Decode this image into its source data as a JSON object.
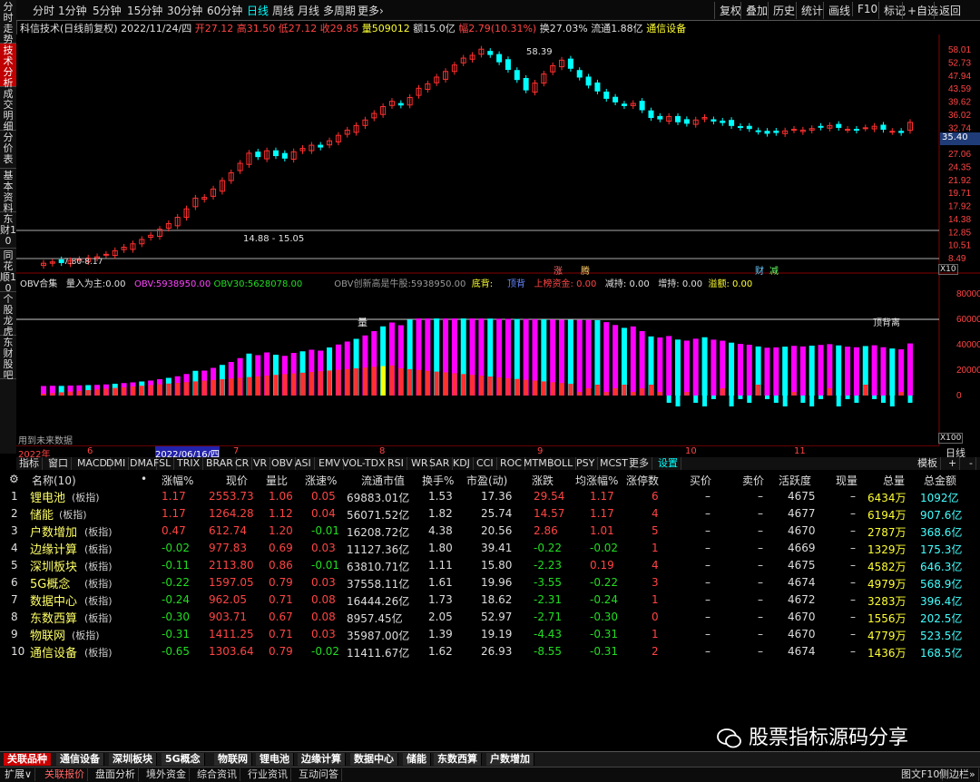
{
  "left_tabs": [
    {
      "label": "分时走势",
      "active": false
    },
    {
      "label": "技术分析",
      "active": true
    },
    {
      "label": "成交明细",
      "active": false
    },
    {
      "label": "分价表",
      "active": false
    },
    {
      "label": "基本资料",
      "active": false
    },
    {
      "label": "东财10",
      "active": false
    },
    {
      "label": "同花顺10",
      "active": false
    },
    {
      "label": "个股龙虎",
      "active": false
    },
    {
      "label": "东财股吧",
      "active": false
    }
  ],
  "toolbar": {
    "periods": [
      "分时",
      "1分钟",
      "5分钟",
      "15分钟",
      "30分钟",
      "60分钟",
      "日线",
      "周线",
      "月线",
      "多周期",
      "更多›"
    ],
    "selected": "日线",
    "right": [
      "复权",
      "叠加",
      "历史",
      "统计",
      "画线",
      "F10",
      "标记",
      "+自选",
      "返回"
    ]
  },
  "info": {
    "stock": "科信技术(日线前复权)",
    "date": "2022/11/24/四",
    "open_label": "开",
    "open": "27.12",
    "high_label": "高",
    "high": "31.50",
    "low_label": "低",
    "low": "27.12",
    "close_label": "收",
    "close": "29.85",
    "vol_label": "量",
    "vol": "509012",
    "amt_label": "额",
    "amt": "15.0亿",
    "chg_label": "幅",
    "chg": "2.79(10.31%)",
    "turn_label": "换",
    "turn": "27.03%",
    "float_label": "流通",
    "float": "1.88亿",
    "industry": "通信设备"
  },
  "price_axis": [
    "58.01",
    "52.73",
    "47.94",
    "43.59",
    "39.62",
    "36.02",
    "32.74",
    "29.77",
    "27.06",
    "24.35",
    "21.92",
    "19.71",
    "17.92",
    "14.38",
    "12.85",
    "10.51",
    "8.49"
  ],
  "price_axis_current": "35.40",
  "scale_label": "X10",
  "annotations": {
    "high": "58.39",
    "range": "14.88 - 15.05",
    "low": "7.80-8.17",
    "zhang": "涨",
    "teng": "腾",
    "cai": "财",
    "jian": "减"
  },
  "obv": {
    "title": "OBV合集",
    "liang_label": "量入为主:",
    "liang": "0.00",
    "obv_label": "OBV:",
    "obv": "5938950.00",
    "obv30_label": "OBV30:",
    "obv30": "5628078.00",
    "newhigh_label": "OBV创新高是牛股:",
    "newhigh": "5938950.00",
    "dibei": "底背:",
    "dingbei": "顶背",
    "shangbang": "上榜资金: 0.00",
    "jianchi": "减持: 0.00",
    "zengchi": "增持: 0.00",
    "yijia": "溢额: 0.00",
    "label_liang": "量",
    "label_beili": "顶背离",
    "future": "用到未来数据",
    "axis": [
      "80000",
      "60000",
      "40000",
      "20000",
      "0"
    ],
    "scale": "X100"
  },
  "chart_data": {
    "type": "candlestick",
    "title": "科信技术(日线前复权)",
    "closes": [
      8.2,
      8.3,
      8.25,
      8.4,
      8.5,
      8.6,
      8.7,
      8.9,
      9.2,
      9.5,
      9.8,
      10.2,
      10.6,
      11.2,
      11.8,
      12.5,
      13.5,
      14.9,
      15.0,
      16.2,
      17.5,
      18.8,
      20.5,
      22.5,
      21.8,
      23.0,
      22.0,
      21.5,
      22.8,
      23.5,
      24.2,
      23.8,
      25.2,
      26.5,
      27.8,
      29.0,
      30.5,
      32.4,
      34.5,
      36.2,
      35.0,
      37.5,
      40.8,
      42.5,
      45.2,
      47.6,
      50.5,
      53.8,
      55.2,
      58.39,
      55.6,
      52.0,
      48.5,
      44.2,
      40.2,
      42.8,
      46.5,
      50.2,
      52.8,
      49.0,
      45.2,
      42.0,
      39.8,
      37.2,
      36.0,
      34.8,
      35.5,
      33.5,
      31.2,
      30.8,
      31.5,
      30.0,
      29.6,
      30.5,
      31.2,
      30.2,
      29.8,
      29.0,
      28.5,
      28.2,
      27.5,
      27.0,
      27.2,
      27.6,
      28.0,
      27.8,
      28.2,
      28.6,
      29.0,
      28.5,
      28.0,
      27.8,
      28.4,
      28.8,
      28.0,
      27.5,
      27.2,
      29.85
    ],
    "ylim": [
      8.49,
      58.01
    ],
    "volume_axis": [
      "80000",
      "60000",
      "40000",
      "20000",
      "0"
    ]
  },
  "dates": [
    {
      "label": "2022年"
    },
    {
      "label": "6"
    },
    {
      "label": "2022/06/16/四",
      "highlight": true
    },
    {
      "label": "7"
    },
    {
      "label": "8"
    },
    {
      "label": "9"
    },
    {
      "label": "10"
    },
    {
      "label": "11"
    }
  ],
  "date_right": "日线",
  "indicator_tabs": [
    "指标",
    "窗口",
    "MACD",
    "DMI",
    "DMA",
    "FSL",
    "TRIX",
    "BRAR",
    "CR",
    "VR",
    "OBV",
    "ASI",
    "EMV",
    "VOL-TDX",
    "RSI",
    "WR",
    "SAR",
    "KDJ",
    "CCI",
    "ROC",
    "MTM",
    "BOLL",
    "PSY",
    "MCST",
    "更多",
    "设置"
  ],
  "indicator_right": [
    "模板",
    "+",
    "-"
  ],
  "table": {
    "headers": [
      "名称(10)",
      "•",
      "涨幅%",
      "现价",
      "量比",
      "涨速%",
      "流通市值",
      "换手%",
      "市盈(动)",
      "涨跌",
      "均涨幅%",
      "涨停数",
      "买价",
      "卖价",
      "活跃度",
      "现量",
      "总量",
      "总金额"
    ],
    "rows": [
      {
        "no": "1",
        "name": "锂电池",
        "tag": "(板指)",
        "chg": "1.17",
        "price": "2553.73",
        "lb": "1.06",
        "speed": "0.05",
        "mv": "69883.01亿",
        "turn": "1.53",
        "pe": "17.36",
        "diff": "29.54",
        "avg": "1.17",
        "zt": "6",
        "buy": "–",
        "sell": "–",
        "act": "4675",
        "cur": "–",
        "tv": "6434万",
        "amt": "1092亿",
        "up": true
      },
      {
        "no": "2",
        "name": "储能",
        "tag": "(板指)",
        "chg": "1.17",
        "price": "1264.28",
        "lb": "1.12",
        "speed": "0.04",
        "mv": "56071.52亿",
        "turn": "1.82",
        "pe": "25.74",
        "diff": "14.57",
        "avg": "1.17",
        "zt": "4",
        "buy": "–",
        "sell": "–",
        "act": "4677",
        "cur": "–",
        "tv": "6194万",
        "amt": "907.6亿",
        "up": true
      },
      {
        "no": "3",
        "name": "户数增加",
        "tag": "(板指)",
        "chg": "0.47",
        "price": "612.74",
        "lb": "1.20",
        "speed": "-0.01",
        "mv": "16208.72亿",
        "turn": "4.38",
        "pe": "20.56",
        "diff": "2.86",
        "avg": "1.01",
        "zt": "5",
        "buy": "–",
        "sell": "–",
        "act": "4670",
        "cur": "–",
        "tv": "2787万",
        "amt": "368.6亿",
        "up": true
      },
      {
        "no": "4",
        "name": "边缘计算",
        "tag": "(板指)",
        "chg": "-0.02",
        "price": "977.83",
        "lb": "0.69",
        "speed": "0.03",
        "mv": "11127.36亿",
        "turn": "1.80",
        "pe": "39.41",
        "diff": "-0.22",
        "avg": "-0.02",
        "zt": "1",
        "buy": "–",
        "sell": "–",
        "act": "4669",
        "cur": "–",
        "tv": "1329万",
        "amt": "175.3亿",
        "up": false
      },
      {
        "no": "5",
        "name": "深圳板块",
        "tag": "(板指)",
        "chg": "-0.11",
        "price": "2113.80",
        "lb": "0.86",
        "speed": "-0.01",
        "mv": "63810.71亿",
        "turn": "1.11",
        "pe": "15.80",
        "diff": "-2.23",
        "avg": "0.19",
        "zt": "4",
        "buy": "–",
        "sell": "–",
        "act": "4675",
        "cur": "–",
        "tv": "4582万",
        "amt": "646.3亿",
        "up": false
      },
      {
        "no": "6",
        "name": "5G概念",
        "tag": "(板指)",
        "chg": "-0.22",
        "price": "1597.05",
        "lb": "0.79",
        "speed": "0.03",
        "mv": "37558.11亿",
        "turn": "1.61",
        "pe": "19.96",
        "diff": "-3.55",
        "avg": "-0.22",
        "zt": "3",
        "buy": "–",
        "sell": "–",
        "act": "4674",
        "cur": "–",
        "tv": "4979万",
        "amt": "568.9亿",
        "up": false
      },
      {
        "no": "7",
        "name": "数据中心",
        "tag": "(板指)",
        "chg": "-0.24",
        "price": "962.05",
        "lb": "0.71",
        "speed": "0.08",
        "mv": "16444.26亿",
        "turn": "1.73",
        "pe": "18.62",
        "diff": "-2.31",
        "avg": "-0.24",
        "zt": "1",
        "buy": "–",
        "sell": "–",
        "act": "4672",
        "cur": "–",
        "tv": "3283万",
        "amt": "396.4亿",
        "up": false
      },
      {
        "no": "8",
        "name": "东数西算",
        "tag": "(板指)",
        "chg": "-0.30",
        "price": "903.71",
        "lb": "0.67",
        "speed": "0.08",
        "mv": "8957.45亿",
        "turn": "2.05",
        "pe": "52.97",
        "diff": "-2.71",
        "avg": "-0.30",
        "zt": "0",
        "buy": "–",
        "sell": "–",
        "act": "4670",
        "cur": "–",
        "tv": "1556万",
        "amt": "202.5亿",
        "up": false
      },
      {
        "no": "9",
        "name": "物联网",
        "tag": "(板指)",
        "chg": "-0.31",
        "price": "1411.25",
        "lb": "0.71",
        "speed": "0.03",
        "mv": "35987.00亿",
        "turn": "1.39",
        "pe": "19.19",
        "diff": "-4.43",
        "avg": "-0.31",
        "zt": "1",
        "buy": "–",
        "sell": "–",
        "act": "4670",
        "cur": "–",
        "tv": "4779万",
        "amt": "523.5亿",
        "up": false
      },
      {
        "no": "10",
        "name": "通信设备",
        "tag": "(板指)",
        "chg": "-0.65",
        "price": "1303.64",
        "lb": "0.79",
        "speed": "-0.02",
        "mv": "11411.67亿",
        "turn": "1.62",
        "pe": "26.93",
        "diff": "-8.55",
        "avg": "-0.31",
        "zt": "2",
        "buy": "–",
        "sell": "–",
        "act": "4674",
        "cur": "–",
        "tv": "1436万",
        "amt": "168.5亿",
        "up": false
      }
    ]
  },
  "sector_tabs": [
    "关联品种",
    "通信设备",
    "深圳板块",
    "5G概念",
    "物联网",
    "锂电池",
    "边缘计算",
    "数据中心",
    "储能",
    "东数西算",
    "户数增加"
  ],
  "status_bar": [
    "扩展∨",
    "关联报价",
    "盘面分析",
    "境外资金",
    "综合资讯",
    "行业资讯",
    "互动问答"
  ],
  "status_right": "图文F10",
  "status_right2": "侧边栏»",
  "watermark": "股票指标源码分享",
  "colors": {
    "up": "#ff3030",
    "down": "#00ffff",
    "obv_up": "#ff00ff",
    "obv_down": "#00ffff"
  }
}
